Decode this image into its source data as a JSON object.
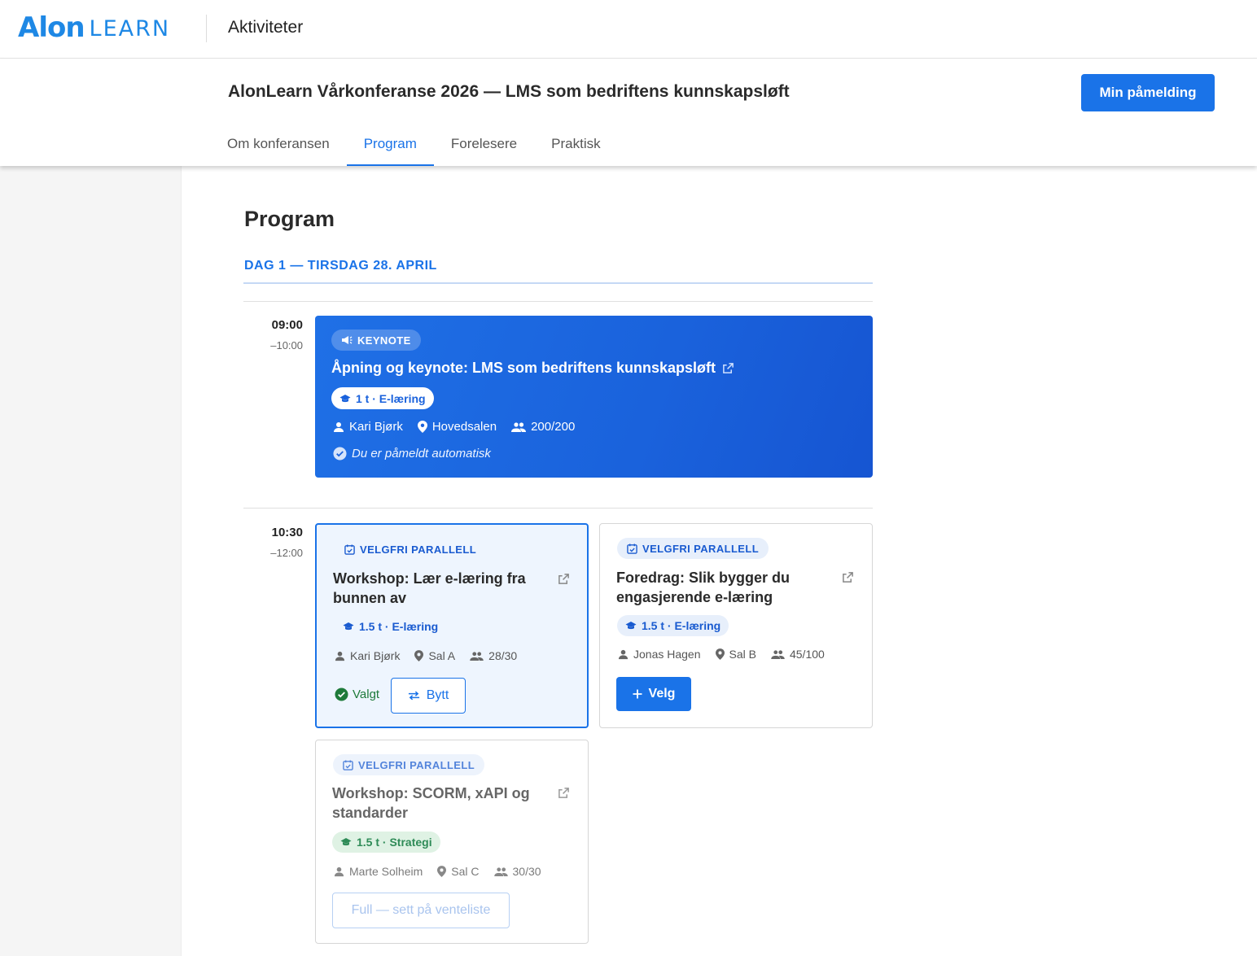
{
  "app": {
    "logo_main": "Alon",
    "logo_sub": "LEARN",
    "section": "Aktiviteter"
  },
  "conference": {
    "title": "AlonLearn Vårkonferanse 2026 — LMS som bedriftens kunnskapsløft",
    "signup_button": "Min påmelding",
    "tabs": [
      "Om konferansen",
      "Program",
      "Forelesere",
      "Praktisk"
    ],
    "active_tab": "Program"
  },
  "program": {
    "heading": "Program",
    "day_label": "DAG 1 — TIRSDAG 28. APRIL",
    "slots": [
      {
        "start": "09:00",
        "end": "–10:00",
        "keynote": {
          "badge": "KEYNOTE",
          "title": "Åpning og keynote: LMS som bedriftens kunnskapsløft",
          "pill": "1 t · E-læring",
          "speaker": "Kari Bjørk",
          "room": "Hovedsalen",
          "capacity": "200/200",
          "note": "Du er påmeldt automatisk"
        }
      },
      {
        "start": "10:30",
        "end": "–12:00",
        "sessions": [
          {
            "badge": "VELGFRI PARALLELL",
            "title": "Workshop: Lær e-læring fra bunnen av",
            "pill": "1.5 t · E-læring",
            "speaker": "Kari Bjørk",
            "room": "Sal A",
            "capacity": "28/30",
            "status": "Valgt",
            "action": "Bytt"
          },
          {
            "badge": "VELGFRI PARALLELL",
            "title": "Foredrag: Slik bygger du engasjerende e-læring",
            "pill": "1.5 t · E-læring",
            "speaker": "Jonas Hagen",
            "room": "Sal B",
            "capacity": "45/100",
            "action": "Velg"
          },
          {
            "badge": "VELGFRI PARALLELL",
            "title": "Workshop: SCORM, xAPI og standarder",
            "pill": "1.5 t · Strategi",
            "speaker": "Marte Solheim",
            "room": "Sal C",
            "capacity": "30/30",
            "action": "Full — sett på venteliste"
          }
        ]
      }
    ]
  },
  "colors": {
    "primary": "#1a73e8",
    "selected_bg": "#eef5fe",
    "success": "#1e7a3a",
    "strategy_pill": "#dff2e4"
  }
}
